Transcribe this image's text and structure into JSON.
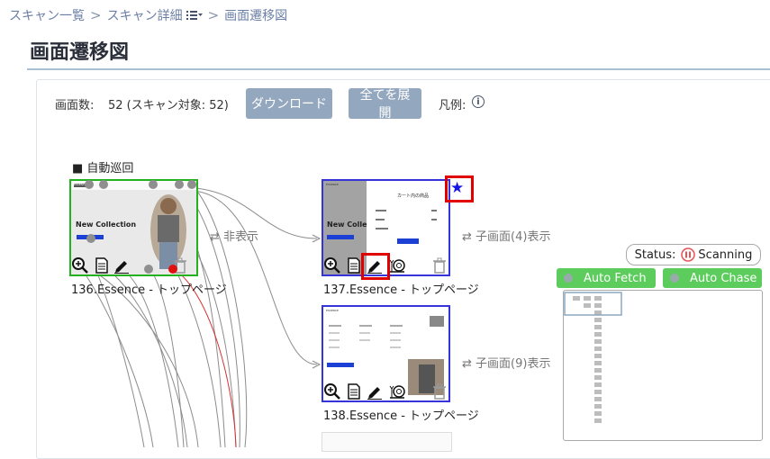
{
  "breadcrumb": {
    "items": [
      "スキャン一覧",
      "スキャン詳細",
      "画面遷移図"
    ]
  },
  "page": {
    "title": "画面遷移図"
  },
  "toolbar": {
    "screen_count_label": "画面数:",
    "screen_count_value": "52 (スキャン対象: 52)",
    "download_label": "ダウンロード",
    "expand_all_label": "全てを展開",
    "legend_label": "凡例:"
  },
  "diagram": {
    "section_label": "■ 自動巡回",
    "nodes": [
      {
        "caption": "136.Essence - トップページ",
        "thumb_text": "New Collection",
        "thumb_logo": "ESSENCE"
      },
      {
        "caption": "137.Essence - トップページ",
        "thumb_text": "New Colle",
        "thumb_logo": "ESSENCE",
        "thumb_side_title": "カート内の商品"
      },
      {
        "caption": "138.Essence - トップページ",
        "thumb_logo": "ESSENCE"
      }
    ],
    "transitions": [
      {
        "label": "非表示"
      },
      {
        "label": "子画面(4)表示"
      },
      {
        "label": "子画面(9)表示"
      }
    ]
  },
  "status": {
    "label": "Status:",
    "value": "Scanning"
  },
  "controls": {
    "auto_fetch": "Auto Fetch",
    "auto_chase": "Auto Chase"
  },
  "colors": {
    "accent_button": "#93a7bf",
    "node_border_start": "#23b120",
    "node_border": "#3434d8",
    "highlight": "#e00000",
    "toggle_on": "#5ccc5c"
  }
}
